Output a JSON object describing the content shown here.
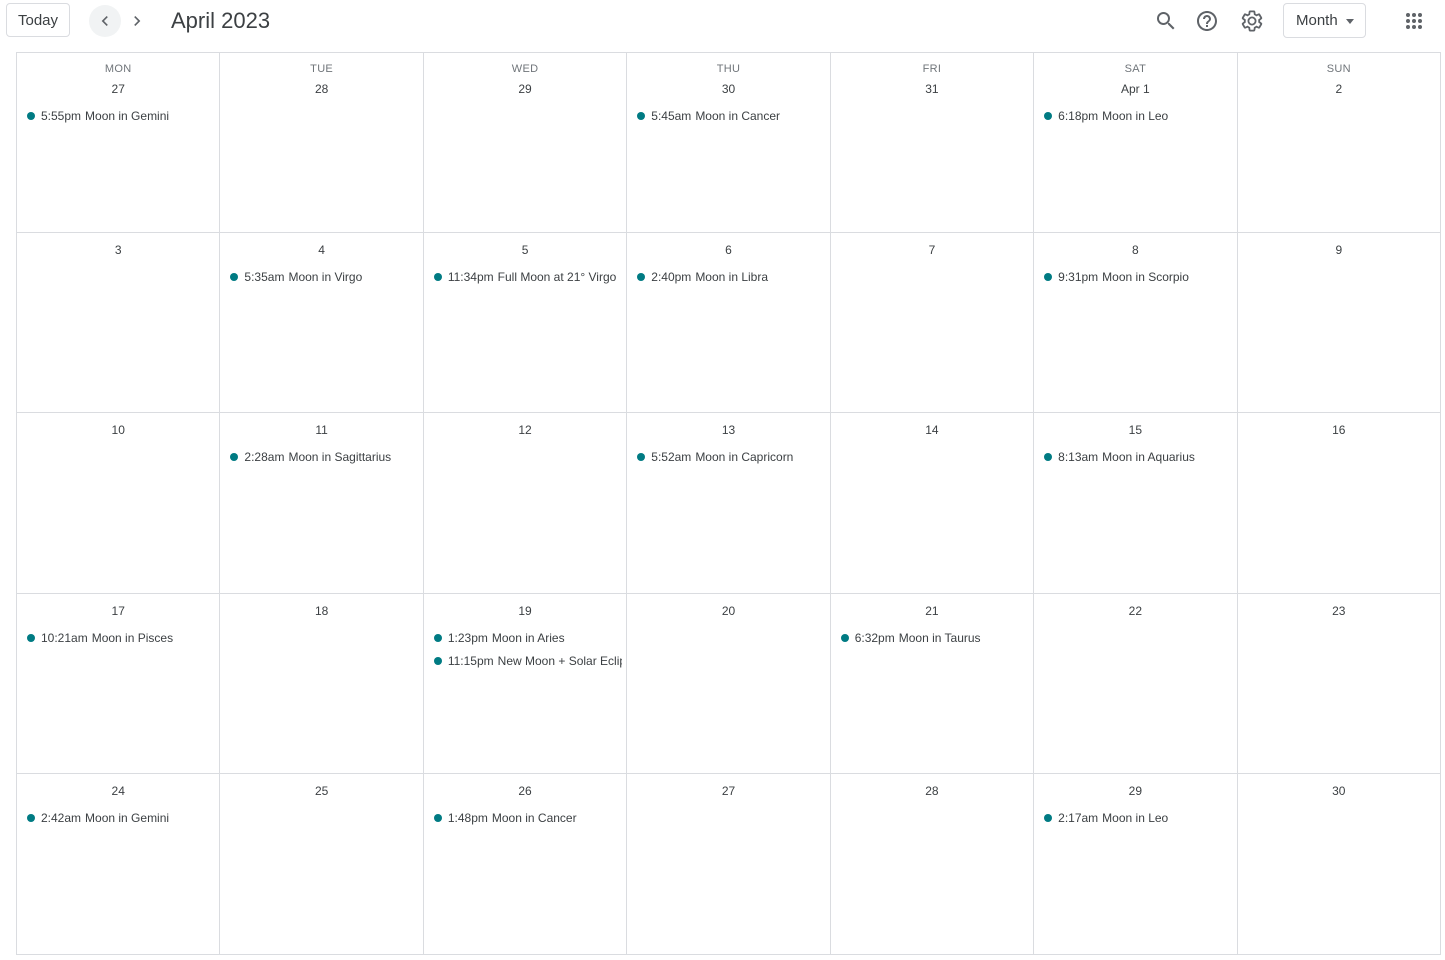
{
  "header": {
    "today_label": "Today",
    "title": "April 2023",
    "view_label": "Month",
    "icons": {
      "prev": "chevron-left-icon",
      "next": "chevron-right-icon",
      "search": "search-icon",
      "help": "help-icon",
      "settings": "gear-icon",
      "apps": "apps-grid-icon"
    }
  },
  "event_color": "#007b83",
  "days_of_week": [
    "MON",
    "TUE",
    "WED",
    "THU",
    "FRI",
    "SAT",
    "SUN"
  ],
  "weeks": [
    [
      {
        "date": "27",
        "events": [
          {
            "time": "5:55pm",
            "title": "Moon in Gemini"
          }
        ]
      },
      {
        "date": "28",
        "events": []
      },
      {
        "date": "29",
        "events": []
      },
      {
        "date": "30",
        "events": [
          {
            "time": "5:45am",
            "title": "Moon in Cancer"
          }
        ]
      },
      {
        "date": "31",
        "events": []
      },
      {
        "date": "Apr 1",
        "events": [
          {
            "time": "6:18pm",
            "title": "Moon in Leo"
          }
        ]
      },
      {
        "date": "2",
        "events": []
      }
    ],
    [
      {
        "date": "3",
        "events": []
      },
      {
        "date": "4",
        "events": [
          {
            "time": "5:35am",
            "title": "Moon in Virgo"
          }
        ]
      },
      {
        "date": "5",
        "events": [
          {
            "time": "11:34pm",
            "title": "Full Moon at 21° Virgo"
          }
        ]
      },
      {
        "date": "6",
        "events": [
          {
            "time": "2:40pm",
            "title": "Moon in Libra"
          }
        ]
      },
      {
        "date": "7",
        "events": []
      },
      {
        "date": "8",
        "events": [
          {
            "time": "9:31pm",
            "title": "Moon in Scorpio"
          }
        ]
      },
      {
        "date": "9",
        "events": []
      }
    ],
    [
      {
        "date": "10",
        "events": []
      },
      {
        "date": "11",
        "events": [
          {
            "time": "2:28am",
            "title": "Moon in Sagittarius"
          }
        ]
      },
      {
        "date": "12",
        "events": []
      },
      {
        "date": "13",
        "events": [
          {
            "time": "5:52am",
            "title": "Moon in Capricorn"
          }
        ]
      },
      {
        "date": "14",
        "events": []
      },
      {
        "date": "15",
        "events": [
          {
            "time": "8:13am",
            "title": "Moon in Aquarius"
          }
        ]
      },
      {
        "date": "16",
        "events": []
      }
    ],
    [
      {
        "date": "17",
        "events": [
          {
            "time": "10:21am",
            "title": "Moon in Pisces"
          }
        ]
      },
      {
        "date": "18",
        "events": []
      },
      {
        "date": "19",
        "events": [
          {
            "time": "1:23pm",
            "title": "Moon in Aries"
          },
          {
            "time": "11:15pm",
            "title": "New Moon + Solar Eclip"
          }
        ]
      },
      {
        "date": "20",
        "events": []
      },
      {
        "date": "21",
        "events": [
          {
            "time": "6:32pm",
            "title": "Moon in Taurus"
          }
        ]
      },
      {
        "date": "22",
        "events": []
      },
      {
        "date": "23",
        "events": []
      }
    ],
    [
      {
        "date": "24",
        "events": [
          {
            "time": "2:42am",
            "title": "Moon in Gemini"
          }
        ]
      },
      {
        "date": "25",
        "events": []
      },
      {
        "date": "26",
        "events": [
          {
            "time": "1:48pm",
            "title": "Moon in Cancer"
          }
        ]
      },
      {
        "date": "27",
        "events": []
      },
      {
        "date": "28",
        "events": []
      },
      {
        "date": "29",
        "events": [
          {
            "time": "2:17am",
            "title": "Moon in Leo"
          }
        ]
      },
      {
        "date": "30",
        "events": []
      }
    ]
  ]
}
